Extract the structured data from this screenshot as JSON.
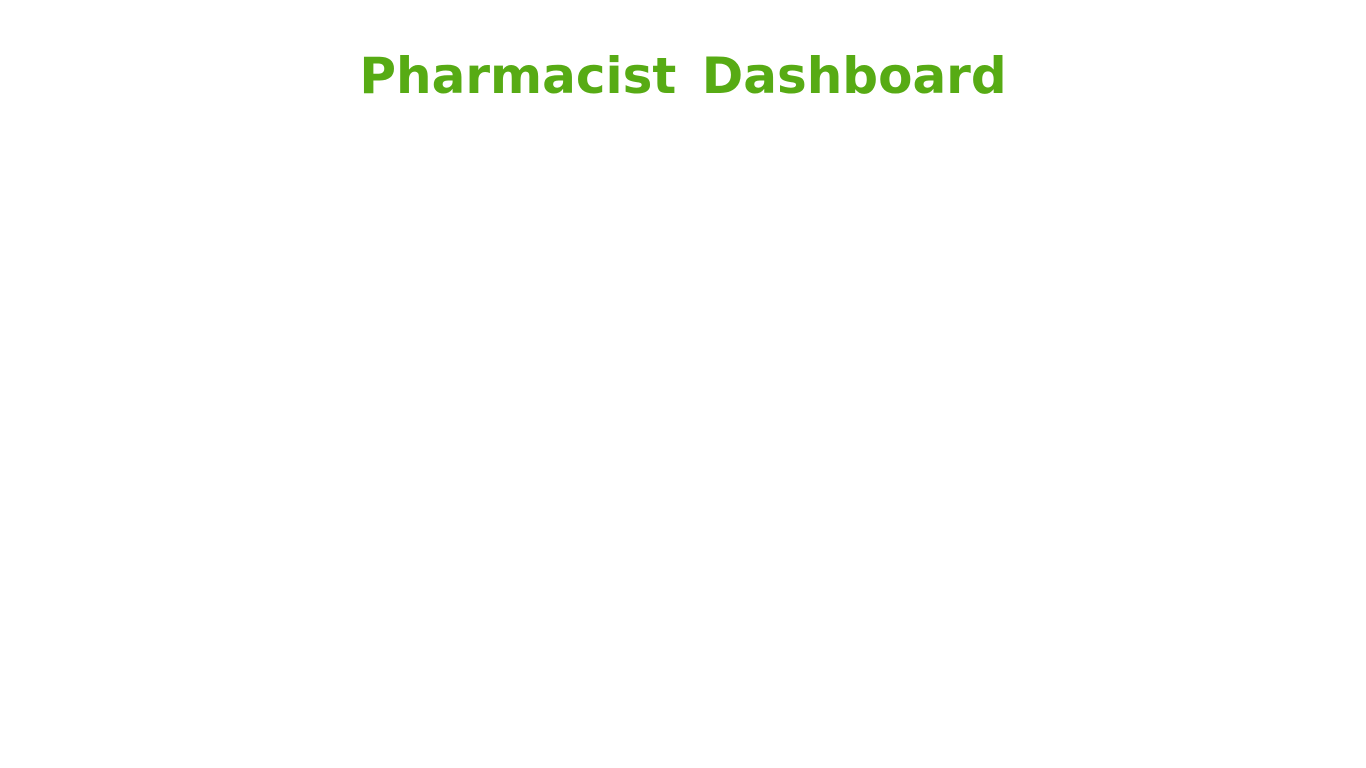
{
  "page": {
    "title_word_1": "Pharmacist",
    "title_word_2": "Dashboard",
    "title_color": "#57ab14",
    "background": "#ffffff"
  }
}
